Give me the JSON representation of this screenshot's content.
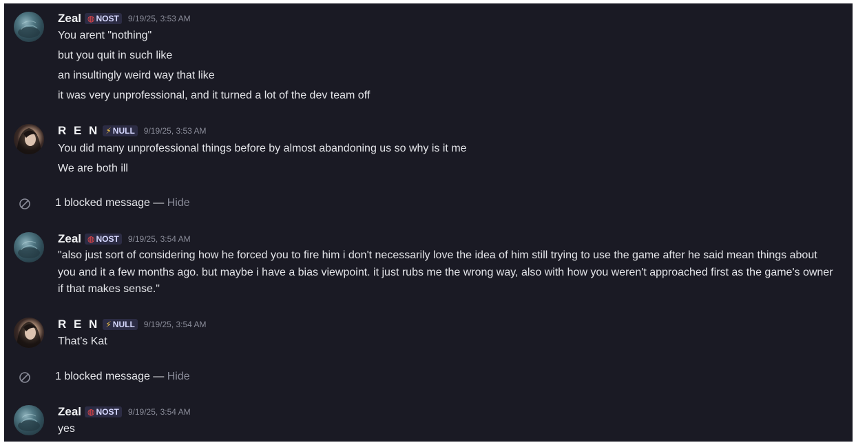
{
  "users": {
    "zeal": {
      "name": "Zeal",
      "tag": "NOST",
      "tag_icon": "ring-icon"
    },
    "ren": {
      "name": "R E N",
      "tag": "NULL",
      "tag_icon": "lightning-icon"
    }
  },
  "messages": [
    {
      "author": "Zeal",
      "tag": "NOST",
      "timestamp": "9/19/25, 3:53 AM",
      "lines": [
        "You arent \"nothing\"",
        "but you quit in such like",
        "an insultingly weird way that like",
        "it was very unprofessional, and it turned a lot of the dev team off"
      ]
    },
    {
      "author": "R E N",
      "tag": "NULL",
      "timestamp": "9/19/25, 3:53 AM",
      "lines": [
        "You did many unprofessional things before by almost abandoning us so why is it me",
        "We are both ill"
      ]
    },
    {
      "blocked_text": "1 blocked message — ",
      "hide_label": "Hide"
    },
    {
      "author": "Zeal",
      "tag": "NOST",
      "timestamp": "9/19/25, 3:54 AM",
      "lines": [
        "\"also just sort of considering how he forced you to fire him i don't necessarily love the idea of him still trying to use the game after he said mean things about you and it a few months ago. but maybe i have a bias viewpoint. it just rubs me the wrong way, also with how you weren't approached first as the game's owner if that makes sense.\""
      ]
    },
    {
      "author": "R E N",
      "tag": "NULL",
      "timestamp": "9/19/25, 3:54 AM",
      "lines": [
        "That’s Kat"
      ]
    },
    {
      "blocked_text": "1 blocked message — ",
      "hide_label": "Hide"
    },
    {
      "author": "Zeal",
      "tag": "NOST",
      "timestamp": "9/19/25, 3:54 AM",
      "lines": [
        "yes"
      ]
    }
  ],
  "colors": {
    "background": "#1a1a24",
    "text": "#e3e4e8",
    "muted": "#8a8c99",
    "nost_icon": "#ff4a4a",
    "null_icon": "#f6c744"
  }
}
